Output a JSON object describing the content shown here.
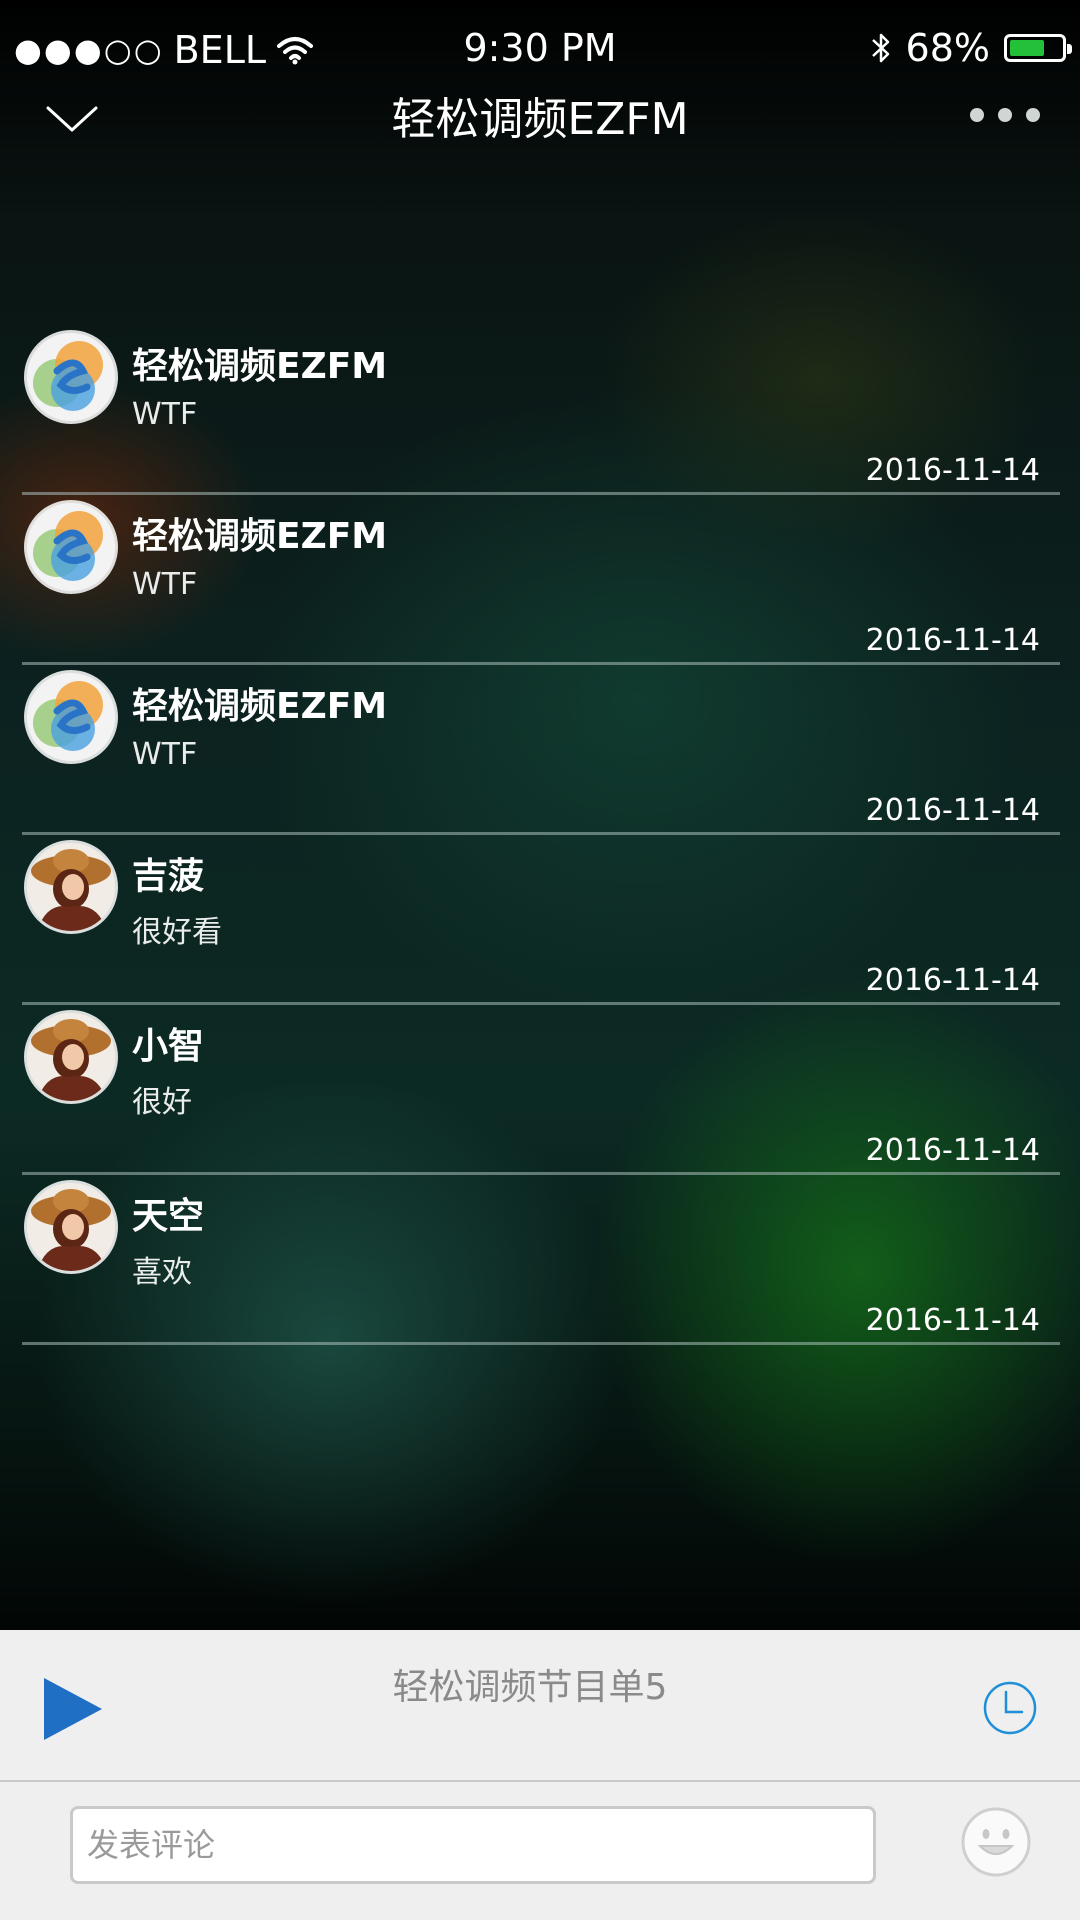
{
  "status_bar": {
    "carrier": "BELL",
    "signal_dots": "●●●○○",
    "time": "9:30 PM",
    "battery_percent": "68%",
    "battery_level": 0.68,
    "battery_color": "#23c13a"
  },
  "nav": {
    "title": "轻松调频EZFM",
    "back_icon": "chevron-down-icon",
    "more_icon": "more-dots-icon"
  },
  "comments": [
    {
      "name": "轻松调频EZFM",
      "text": "WTF",
      "date": "2016-11-14",
      "avatar": "ezfm-logo"
    },
    {
      "name": "轻松调频EZFM",
      "text": "WTF",
      "date": "2016-11-14",
      "avatar": "ezfm-logo"
    },
    {
      "name": "轻松调频EZFM",
      "text": "WTF",
      "date": "2016-11-14",
      "avatar": "ezfm-logo"
    },
    {
      "name": "吉菠",
      "text": "很好看",
      "date": "2016-11-14",
      "avatar": "user-photo"
    },
    {
      "name": "小智",
      "text": "很好",
      "date": "2016-11-14",
      "avatar": "user-photo"
    },
    {
      "name": "天空",
      "text": "喜欢",
      "date": "2016-11-14",
      "avatar": "user-photo"
    }
  ],
  "player": {
    "title": "轻松调频节目单5",
    "play_icon": "play-icon",
    "timer_icon": "clock-icon",
    "accent_color": "#1f6fc4"
  },
  "input": {
    "placeholder": "发表评论",
    "emoji_icon": "smiley-face-icon"
  }
}
